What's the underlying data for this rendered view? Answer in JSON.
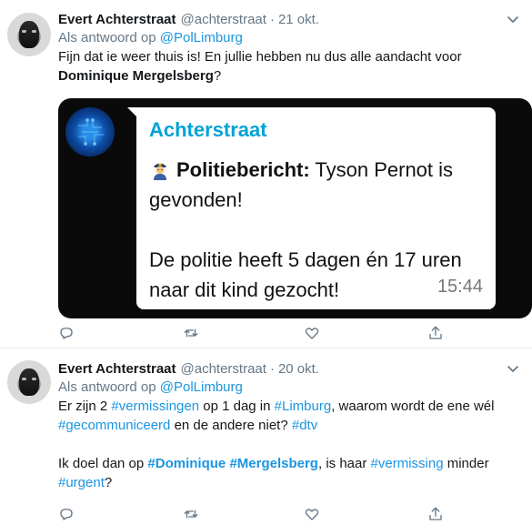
{
  "tweets": [
    {
      "name": "Evert Achterstraat",
      "handle": "@achterstraat",
      "separator": "·",
      "date": "21 okt.",
      "reply_prefix": "Als antwoord op",
      "reply_mention": "@PolLimburg",
      "text_line1": "Fijn dat ie weer thuis is! En jullie hebben nu dus alle aandacht voor",
      "text_bold": "Dominique Mergelsberg",
      "text_end": "?",
      "media": {
        "sender": "Achterstraat",
        "msg_bold": "Politiebericht:",
        "msg_after_bold": " Tyson Pernot is gevonden!",
        "msg_line2": "De politie heeft 5 dagen én 17 uren naar dit kind gezocht!",
        "time": "15:44"
      }
    },
    {
      "name": "Evert Achterstraat",
      "handle": "@achterstraat",
      "separator": "·",
      "date": "20 okt.",
      "reply_prefix": "Als antwoord op",
      "reply_mention": "@PolLimburg",
      "p1": {
        "t1": "Er zijn 2 ",
        "h1": "#vermissingen",
        "t2": " op 1 dag in ",
        "h2": "#Limburg",
        "t3": ", waarom wordt de ene wél",
        "h3": "#gecommuniceerd",
        "t4": " en de andere niet? ",
        "h4": "#dtv"
      },
      "p2": {
        "t1": "Ik doel dan op ",
        "h1": "#Dominique",
        "t2": " ",
        "h2": "#Mergelsberg",
        "t3": ", is haar ",
        "h3": "#vermissing",
        "t4": " minder",
        "h4": "#urgent",
        "t5": "?"
      }
    }
  ],
  "icons": {
    "caret": "chevron-down-icon",
    "reply": "reply-icon",
    "retweet": "retweet-icon",
    "like": "heart-icon",
    "share": "share-icon",
    "police": "police-officer-emoji"
  },
  "colors": {
    "link": "#1b95e0",
    "muted": "#657786",
    "text": "#14171a",
    "sender": "#00a3d4",
    "divider": "#e6ecf0"
  }
}
